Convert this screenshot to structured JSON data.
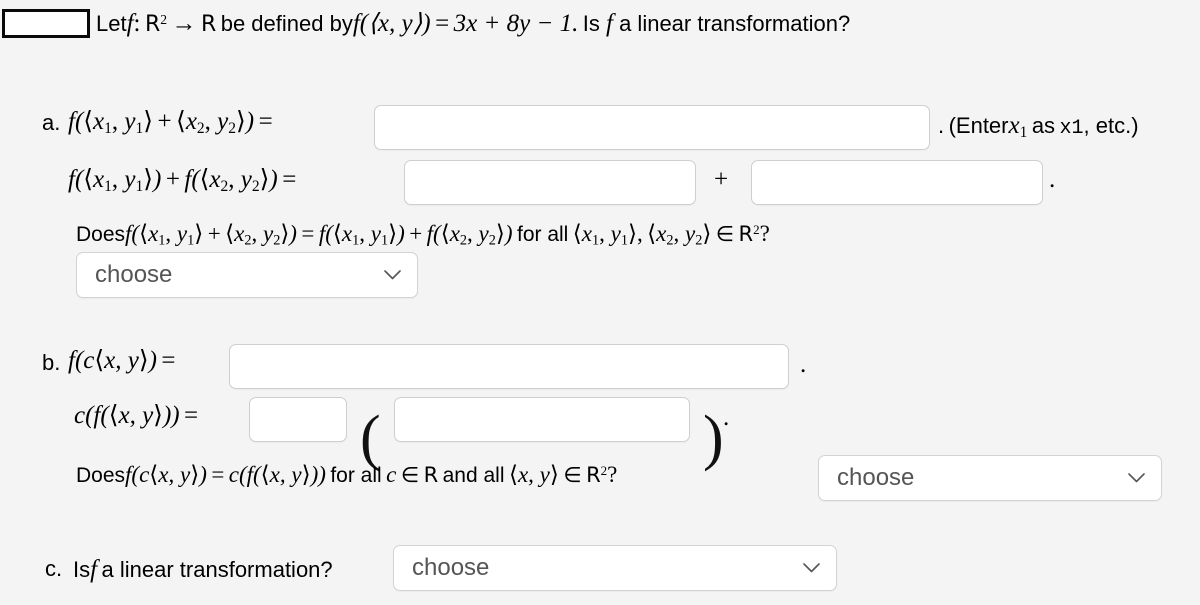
{
  "page": {
    "background_color": "#f4f4f4",
    "text_color": "#000000"
  },
  "prompt": {
    "marker_box_value": "",
    "let": "Let",
    "f": "f",
    "colon": ":",
    "domain": "R",
    "domain_power": "2",
    "arrow": "→",
    "codomain": "R",
    "defined_by": "be defined by",
    "definition_lhs": "f(⟨x, y⟩)",
    "equals": "=",
    "definition_rhs": "3x + 8y − 1.",
    "question": "Is f a linear transformation?",
    "full_text": "Let f : R² → R be defined by f(⟨x, y⟩) = 3x + 8y − 1. Is f a linear transformation?"
  },
  "parts": {
    "a": {
      "label": "a.",
      "line1_lhs": "f(⟨x₁, y₁⟩ + ⟨x₂, y₂⟩) =",
      "line1_answer_value": "",
      "line1_suffix_period": ".",
      "hint": "(Enter x₁ as x1, etc.)",
      "hint_prefix": "(Enter",
      "hint_var": "x",
      "hint_var_sub": "1",
      "hint_as": "as",
      "hint_mono": "x1",
      "hint_suffix": ", etc.)",
      "line2_lhs": "f(⟨x₁, y₁⟩) + f(⟨x₂, y₂⟩) =",
      "line2_answer1_value": "",
      "line2_plus": "+",
      "line2_answer2_value": "",
      "line2_period": ".",
      "does_question": "Does f(⟨x₁, y₁⟩ + ⟨x₂, y₂⟩) = f(⟨x₁, y₁⟩) + f(⟨x₂, y₂⟩) for all ⟨x₁, y₁⟩, ⟨x₂, y₂⟩ ∈ R²?",
      "does_word": "Does",
      "for_all": "for all",
      "select_value": "choose"
    },
    "b": {
      "label": "b.",
      "line1_lhs": "f(c⟨x, y⟩) =",
      "line1_answer_value": "",
      "line1_period": ".",
      "line2_lhs": "c(f(⟨x, y⟩)) =",
      "line2_answer1_value": "",
      "line2_open_paren": "(",
      "line2_answer2_value": "",
      "line2_close_paren": ")",
      "line2_period": ".",
      "does_question": "Does f(c⟨x, y⟩) = c(f(⟨x, y⟩)) for all c ∈ R and all ⟨x, y⟩ ∈ R²?",
      "does_word": "Does",
      "for_all_c": "for all",
      "and_all": "and all",
      "select_value": "choose"
    },
    "c": {
      "label": "c.",
      "question": "Is f a linear transformation?",
      "is_word": "Is",
      "rest": "a linear transformation?",
      "select_value": "choose"
    }
  },
  "icons": {
    "chevron_down": "chevron-down-icon"
  }
}
